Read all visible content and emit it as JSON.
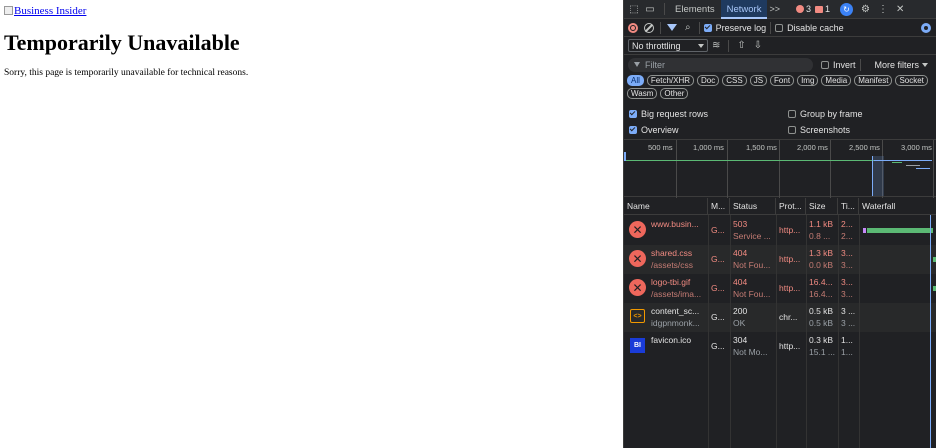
{
  "page": {
    "logo_alt": "Business Insider",
    "heading": "Temporarily Unavailable",
    "message": "Sorry, this page is temporarily unavailable for technical reasons."
  },
  "devtools": {
    "tabs": [
      "Elements",
      "Network"
    ],
    "active_tab": "Network",
    "more_tabs": ">>",
    "error_count": "3",
    "warning_count": "1",
    "toolbar": {
      "preserve_log": "Preserve log",
      "disable_cache": "Disable cache",
      "throttling": "No throttling"
    },
    "filter": {
      "placeholder": "Filter",
      "invert": "Invert",
      "more_filters": "More filters"
    },
    "chips": [
      "All",
      "Fetch/XHR",
      "Doc",
      "CSS",
      "JS",
      "Font",
      "Img",
      "Media",
      "Manifest",
      "Socket",
      "Wasm",
      "Other"
    ],
    "options": {
      "big_request_rows": "Big request rows",
      "group_by_frame": "Group by frame",
      "overview": "Overview",
      "screenshots": "Screenshots"
    },
    "timeline_ticks": [
      "500 ms",
      "1,000 ms",
      "1,500 ms",
      "2,000 ms",
      "2,500 ms",
      "3,000 ms"
    ],
    "columns": [
      "Name",
      "M...",
      "Status",
      "Prot...",
      "Size",
      "Ti...",
      "Waterfall"
    ],
    "requests": [
      {
        "name": "www.busin...",
        "name2": "",
        "method": "G...",
        "status": "503",
        "status2": "Service ...",
        "protocol": "http...",
        "size": "1.1 kB",
        "size2": "0.8 ...",
        "time": "2...",
        "time2": "2...",
        "error": true,
        "icon": "error-icon"
      },
      {
        "name": "shared.css",
        "name2": "/assets/css",
        "method": "G...",
        "status": "404",
        "status2": "Not Fou...",
        "protocol": "http...",
        "size": "1.3 kB",
        "size2": "0.0 kB",
        "time": "3...",
        "time2": "3...",
        "error": true,
        "icon": "error-icon"
      },
      {
        "name": "logo-tbi.gif",
        "name2": "/assets/ima...",
        "method": "G...",
        "status": "404",
        "status2": "Not Fou...",
        "protocol": "http...",
        "size": "16.4...",
        "size2": "16.4...",
        "time": "3...",
        "time2": "3...",
        "error": true,
        "icon": "error-icon"
      },
      {
        "name": "content_sc...",
        "name2": "idgpnmonk...",
        "method": "G...",
        "status": "200",
        "status2": "OK",
        "protocol": "chr...",
        "size": "0.5 kB",
        "size2": "0.5 kB",
        "time": "3 ...",
        "time2": "3 ...",
        "error": false,
        "icon": "code-icon"
      },
      {
        "name": "favicon.ico",
        "name2": "",
        "method": "G...",
        "status": "304",
        "status2": "Not Mo...",
        "protocol": "http...",
        "size": "0.3 kB",
        "size2": "15.1 ...",
        "time": "1...",
        "time2": "1...",
        "error": false,
        "icon": "bi-favicon-icon"
      }
    ],
    "colors": {
      "error": "#f28b82",
      "accent": "#7cacf8",
      "waterfall": "#5bb974",
      "panel_bg": "#202124"
    }
  }
}
